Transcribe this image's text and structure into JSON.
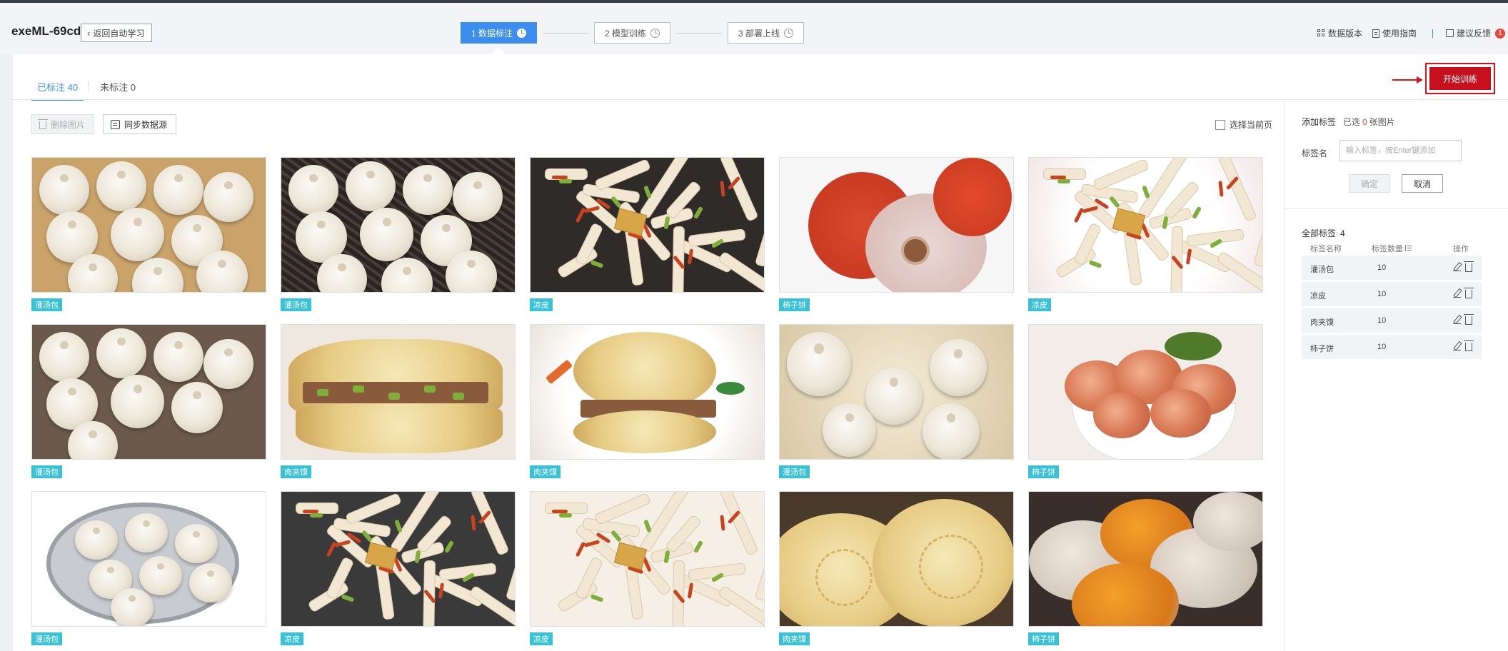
{
  "header": {
    "app_title": "exeML-69cd",
    "back_label": "返回自动学习",
    "steps": [
      {
        "label": "1 数据标注"
      },
      {
        "label": "2 模型训练"
      },
      {
        "label": "3 部署上线"
      }
    ],
    "right_links": {
      "data_version": "数据版本",
      "guide": "使用指南",
      "feedback": "建议反馈",
      "feedback_badge": "1"
    }
  },
  "tabs": {
    "labeled": "已标注 40",
    "unlabeled": "未标注 0"
  },
  "start_training": "开始训练",
  "toolbar": {
    "delete_label": "删除图片",
    "sync_label": "同步数据源",
    "select_page_label": "选择当前页"
  },
  "images": [
    {
      "tag": "灌汤包",
      "kind": "buns-steamer"
    },
    {
      "tag": "灌汤包",
      "kind": "buns-dark"
    },
    {
      "tag": "凉皮",
      "kind": "noodles"
    },
    {
      "tag": "柿子饼",
      "kind": "persimmon-cut"
    },
    {
      "tag": "凉皮",
      "kind": "noodles-plate"
    },
    {
      "tag": "灌汤包",
      "kind": "buns-close"
    },
    {
      "tag": "肉夹馍",
      "kind": "roujiamo-side"
    },
    {
      "tag": "肉夹馍",
      "kind": "roujiamo-plate"
    },
    {
      "tag": "灌汤包",
      "kind": "buns-spoon"
    },
    {
      "tag": "柿子饼",
      "kind": "persimmon-bowl"
    },
    {
      "tag": "灌汤包",
      "kind": "buns-basket"
    },
    {
      "tag": "凉皮",
      "kind": "noodles-spicy"
    },
    {
      "tag": "凉皮",
      "kind": "noodles-cucumber"
    },
    {
      "tag": "肉夹馍",
      "kind": "flatbread"
    },
    {
      "tag": "柿子饼",
      "kind": "persimmon-dried"
    }
  ],
  "right_panel": {
    "add_label_title": "添加标签",
    "selected_prefix": "已选",
    "selected_count": "0",
    "selected_suffix": "张图片",
    "label_name": "标签名",
    "input_placeholder": "输入标签，按Enter键添加",
    "confirm": "确定",
    "cancel": "取消",
    "all_labels": "全部标签",
    "all_labels_count": "4",
    "col_name": "标签名称",
    "col_count": "标签数量",
    "col_ops": "操作",
    "labels": [
      {
        "name": "灌汤包",
        "count": "10"
      },
      {
        "name": "凉皮",
        "count": "10"
      },
      {
        "name": "肉夹馍",
        "count": "10"
      },
      {
        "name": "柿子饼",
        "count": "10"
      }
    ]
  },
  "colors": {
    "accent": "#3b8df0",
    "tag_bg": "#39c2d7",
    "start_btn": "#c6101d",
    "highlight": "#d9121a"
  }
}
